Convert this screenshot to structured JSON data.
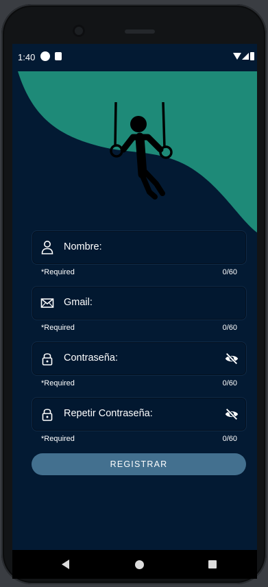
{
  "status_bar": {
    "time": "1:40",
    "icons": [
      "app-notification-icon",
      "sd-card-icon",
      "wifi-icon",
      "signal-icon",
      "battery-icon"
    ]
  },
  "hero": {
    "illustration": "gymnast-on-rings-icon",
    "background_color": "#1e8a78"
  },
  "form": {
    "fields": [
      {
        "label": "Nombre:",
        "icon": "person-icon",
        "helper": "*Required",
        "counter": "0/60",
        "has_visibility_toggle": false
      },
      {
        "label": "Gmail:",
        "icon": "mail-icon",
        "helper": "*Required",
        "counter": "0/60",
        "has_visibility_toggle": false
      },
      {
        "label": "Contraseña:",
        "icon": "lock-icon",
        "helper": "*Required",
        "counter": "0/60",
        "has_visibility_toggle": true
      },
      {
        "label": "Repetir Contraseña:",
        "icon": "lock-icon",
        "helper": "*Required",
        "counter": "0/60",
        "has_visibility_toggle": true
      }
    ],
    "submit_label": "REGISTRAR"
  },
  "colors": {
    "screen_background": "#031a33",
    "accent_teal": "#1e8a78",
    "button": "#43708f"
  },
  "nav_bar": {
    "buttons": [
      "back-icon",
      "home-icon",
      "recents-icon"
    ]
  }
}
